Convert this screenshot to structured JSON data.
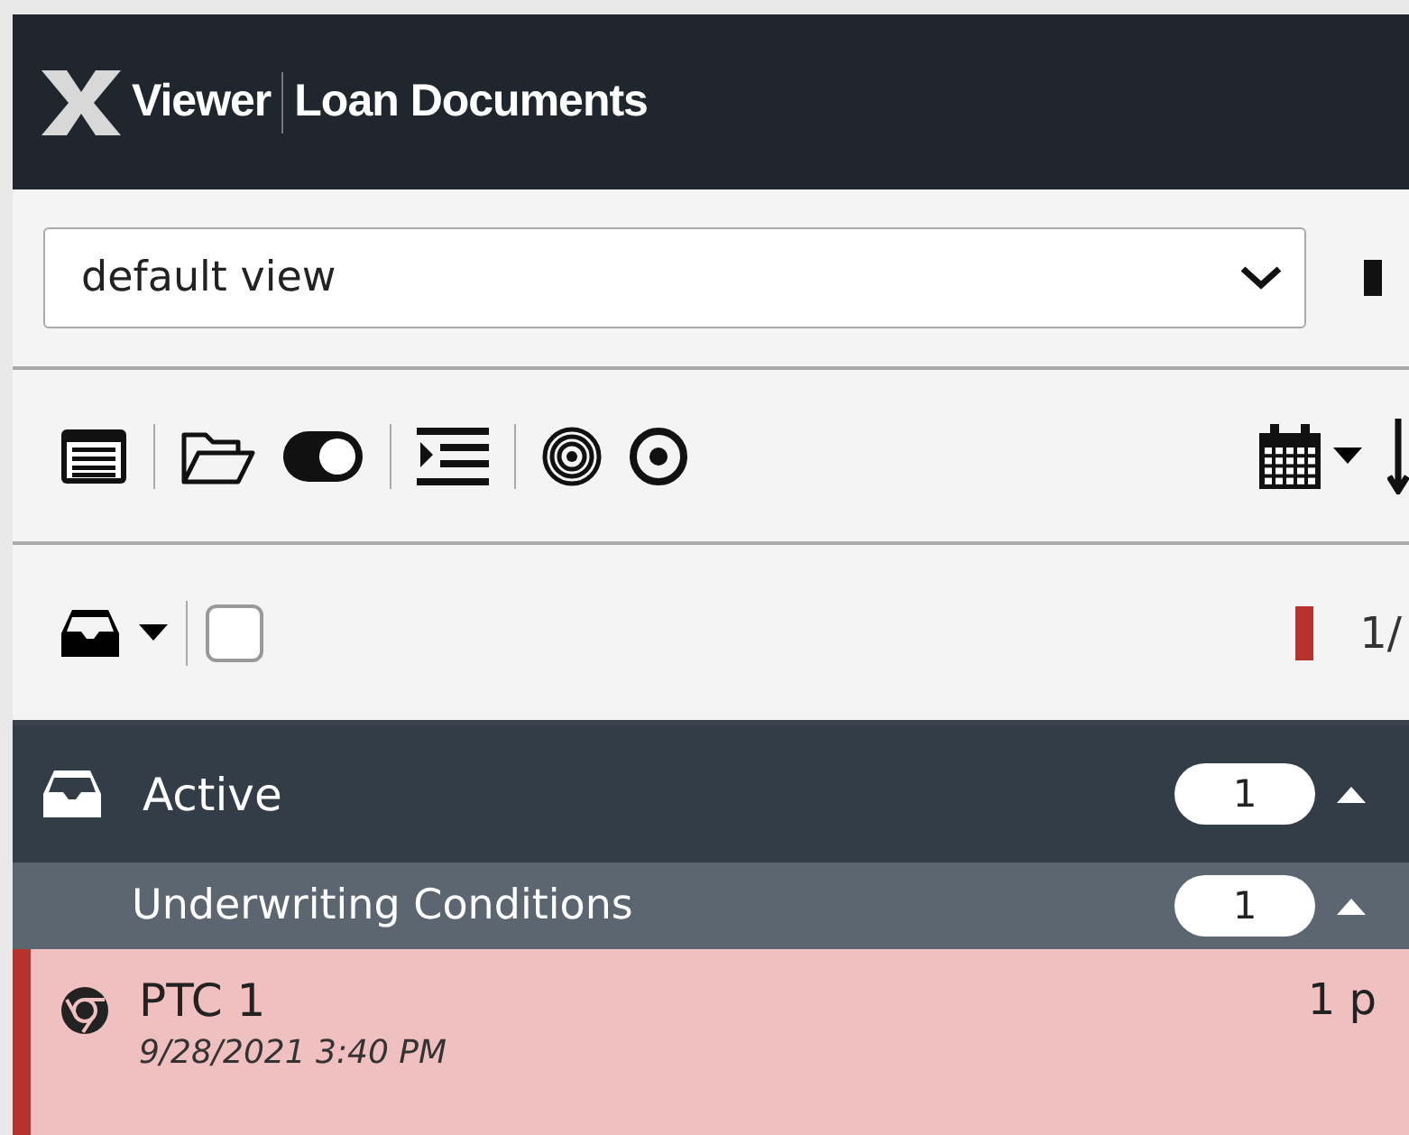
{
  "header": {
    "app": "Viewer",
    "title": "Loan Documents"
  },
  "view_select": {
    "value": "default view"
  },
  "list_toolbar": {
    "select_all_checked": false,
    "page_indicator": "1/"
  },
  "groups": [
    {
      "label": "Active",
      "count": "1",
      "expanded": true,
      "subgroups": [
        {
          "label": "Underwriting Conditions",
          "count": "1",
          "expanded": true,
          "items": [
            {
              "title": "PTC 1",
              "date": "9/28/2021 3:40 PM",
              "pages": "1 p",
              "selected": true
            }
          ]
        }
      ]
    }
  ]
}
